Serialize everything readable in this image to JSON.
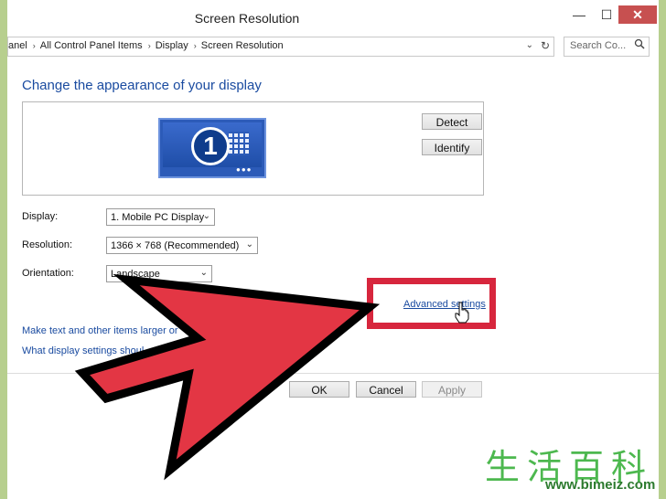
{
  "window": {
    "title": "Screen Resolution",
    "minimize": "—",
    "maximize": "☐",
    "close": "✕"
  },
  "address": {
    "crumbs": [
      "anel",
      "All Control Panel Items",
      "Display",
      "Screen Resolution"
    ],
    "separator": "›",
    "dropdown": "⌄",
    "refresh": "↻"
  },
  "search": {
    "placeholder": "Search Co...",
    "icon": "search-icon"
  },
  "main": {
    "heading": "Change the appearance of your display",
    "monitor_number": "1",
    "detect_label": "Detect",
    "identify_label": "Identify"
  },
  "settings": {
    "display_label": "Display:",
    "display_value": "1. Mobile PC Display",
    "resolution_label": "Resolution:",
    "resolution_value": "1366 × 768 (Recommended)",
    "orientation_label": "Orientation:",
    "orientation_value": "Landscape"
  },
  "links": {
    "advanced": "Advanced settings",
    "text_size": "Make text and other items larger or",
    "which_settings": "What display settings shoul"
  },
  "footer": {
    "ok_label": "OK",
    "cancel_label": "Cancel",
    "apply_label": "Apply"
  },
  "overlay": {
    "highlight_color": "#d7263d",
    "arrow_color": "#e33644"
  },
  "watermark": {
    "chinese": "生活百科",
    "url": "www.bimeiz.com"
  }
}
